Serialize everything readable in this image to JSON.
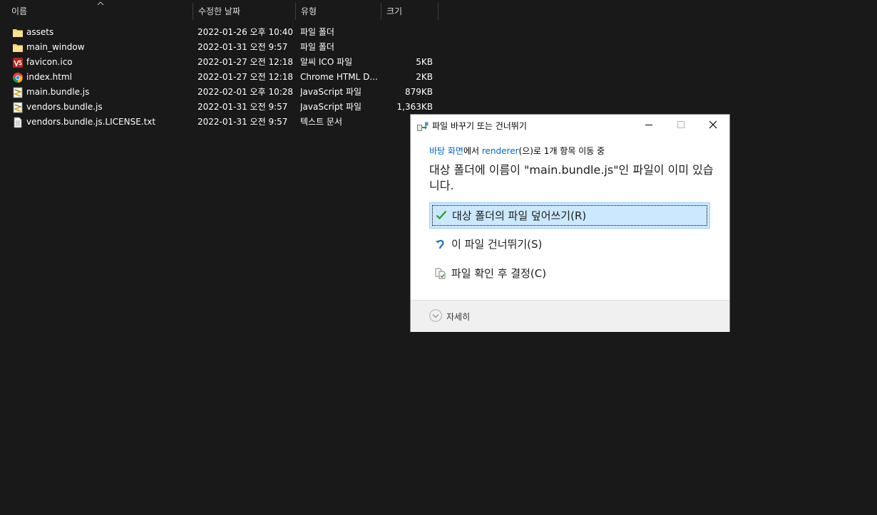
{
  "explorer": {
    "columns": {
      "name": "이름",
      "date": "수정한 날짜",
      "type": "유형",
      "size": "크기"
    },
    "files": [
      {
        "name": "assets",
        "date": "2022-01-26 오후 10:40",
        "type": "파일 폴더",
        "size": "",
        "icon": "folder-icon"
      },
      {
        "name": "main_window",
        "date": "2022-01-31 오전 9:57",
        "type": "파일 폴더",
        "size": "",
        "icon": "folder-icon"
      },
      {
        "name": "favicon.ico",
        "date": "2022-01-27 오전 12:18",
        "type": "알씨 ICO 파일",
        "size": "5KB",
        "icon": "ico-file-icon"
      },
      {
        "name": "index.html",
        "date": "2022-01-27 오전 12:18",
        "type": "Chrome HTML D...",
        "size": "2KB",
        "icon": "chrome-icon"
      },
      {
        "name": "main.bundle.js",
        "date": "2022-02-01 오후 10:28",
        "type": "JavaScript 파일",
        "size": "879KB",
        "icon": "js-file-icon"
      },
      {
        "name": "vendors.bundle.js",
        "date": "2022-01-31 오전 9:57",
        "type": "JavaScript 파일",
        "size": "1,363KB",
        "icon": "js-file-icon"
      },
      {
        "name": "vendors.bundle.js.LICENSE.txt",
        "date": "2022-01-31 오전 9:57",
        "type": "텍스트 문서",
        "size": "",
        "icon": "text-file-icon"
      }
    ]
  },
  "dialog": {
    "title": "파일 바꾸기 또는 건너뛰기",
    "source": "바탕 화면",
    "mid1": "에서 ",
    "dest": "renderer",
    "mid2": "(으)로 1개 항목 이동 중",
    "message": "대상 폴더에 이름이 \"main.bundle.js\"인 파일이 이미 있습니다.",
    "options": {
      "replace": "대상 폴더의 파일 덮어쓰기(R)",
      "skip": "이 파일 건너뛰기(S)",
      "compare": "파일 확인 후 결정(C)"
    },
    "more_details": "자세히"
  },
  "colors": {
    "explorer_bg": "#191919",
    "selected_option_bg": "#cce8ff",
    "link": "#0066cc",
    "check": "#2e9a2e"
  }
}
